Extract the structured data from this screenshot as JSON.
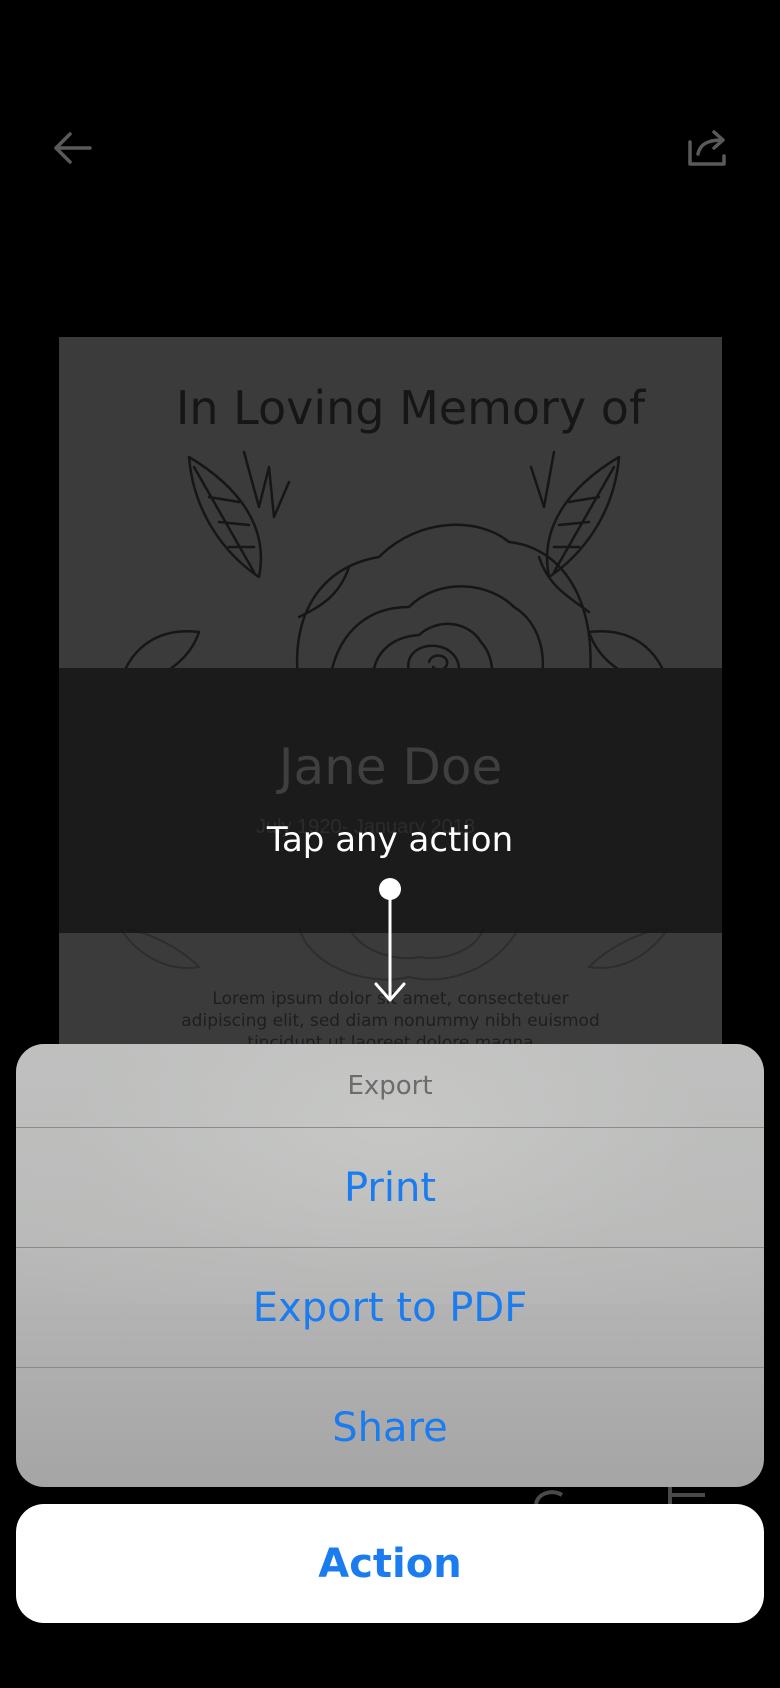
{
  "nav": {
    "back_icon": "arrow-left-icon",
    "share_icon": "share-icon"
  },
  "card": {
    "title": "In Loving Memory of",
    "name": "Jane Doe",
    "dates": "July 1920- January 2018",
    "body": "Lorem ipsum dolor sit amet, consectetuer adipiscing elit, sed diam nonummy nibh euismod tincidunt ut laoreet dolore magna"
  },
  "hint": {
    "text": "Tap any action"
  },
  "sheet": {
    "header": "Export",
    "actions": [
      {
        "label": "Print"
      },
      {
        "label": "Export to PDF"
      },
      {
        "label": "Share"
      }
    ],
    "cancel_label": "Action"
  },
  "colors": {
    "accent": "#1b7cf0",
    "background": "#000000",
    "sheet": "#bdbebd"
  }
}
